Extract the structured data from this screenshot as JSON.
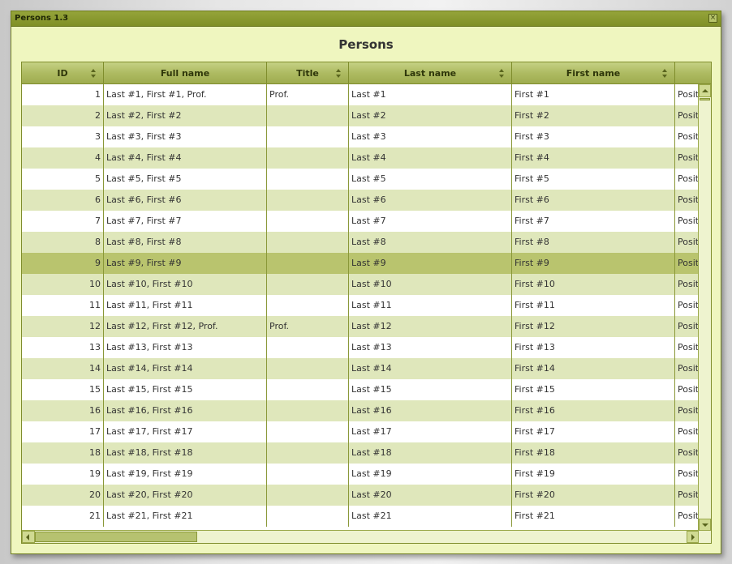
{
  "window": {
    "title": "Persons 1.3",
    "close_glyph": "×"
  },
  "page": {
    "heading": "Persons"
  },
  "table": {
    "columns": [
      {
        "label": "ID",
        "sortable": true
      },
      {
        "label": "Full name",
        "sortable": false
      },
      {
        "label": "Title",
        "sortable": true
      },
      {
        "label": "Last name",
        "sortable": true
      },
      {
        "label": "First name",
        "sortable": true
      },
      {
        "label": "",
        "sortable": false
      }
    ],
    "selected_row": 9,
    "rows": [
      {
        "id": "1",
        "full_name": "Last #1, First #1, Prof.",
        "title": "Prof.",
        "last_name": "Last #1",
        "first_name": "First #1",
        "position": "Posit"
      },
      {
        "id": "2",
        "full_name": "Last #2, First #2",
        "title": "",
        "last_name": "Last #2",
        "first_name": "First #2",
        "position": "Posit"
      },
      {
        "id": "3",
        "full_name": "Last #3, First #3",
        "title": "",
        "last_name": "Last #3",
        "first_name": "First #3",
        "position": "Posit"
      },
      {
        "id": "4",
        "full_name": "Last #4, First #4",
        "title": "",
        "last_name": "Last #4",
        "first_name": "First #4",
        "position": "Posit"
      },
      {
        "id": "5",
        "full_name": "Last #5, First #5",
        "title": "",
        "last_name": "Last #5",
        "first_name": "First #5",
        "position": "Posit"
      },
      {
        "id": "6",
        "full_name": "Last #6, First #6",
        "title": "",
        "last_name": "Last #6",
        "first_name": "First #6",
        "position": "Posit"
      },
      {
        "id": "7",
        "full_name": "Last #7, First #7",
        "title": "",
        "last_name": "Last #7",
        "first_name": "First #7",
        "position": "Posit"
      },
      {
        "id": "8",
        "full_name": "Last #8, First #8",
        "title": "",
        "last_name": "Last #8",
        "first_name": "First #8",
        "position": "Posit"
      },
      {
        "id": "9",
        "full_name": "Last #9, First #9",
        "title": "",
        "last_name": "Last #9",
        "first_name": "First #9",
        "position": "Posit"
      },
      {
        "id": "10",
        "full_name": "Last #10, First #10",
        "title": "",
        "last_name": "Last #10",
        "first_name": "First #10",
        "position": "Posit"
      },
      {
        "id": "11",
        "full_name": "Last #11, First #11",
        "title": "",
        "last_name": "Last #11",
        "first_name": "First #11",
        "position": "Posit"
      },
      {
        "id": "12",
        "full_name": "Last #12, First #12, Prof.",
        "title": "Prof.",
        "last_name": "Last #12",
        "first_name": "First #12",
        "position": "Posit"
      },
      {
        "id": "13",
        "full_name": "Last #13, First #13",
        "title": "",
        "last_name": "Last #13",
        "first_name": "First #13",
        "position": "Posit"
      },
      {
        "id": "14",
        "full_name": "Last #14, First #14",
        "title": "",
        "last_name": "Last #14",
        "first_name": "First #14",
        "position": "Posit"
      },
      {
        "id": "15",
        "full_name": "Last #15, First #15",
        "title": "",
        "last_name": "Last #15",
        "first_name": "First #15",
        "position": "Posit"
      },
      {
        "id": "16",
        "full_name": "Last #16, First #16",
        "title": "",
        "last_name": "Last #16",
        "first_name": "First #16",
        "position": "Posit"
      },
      {
        "id": "17",
        "full_name": "Last #17, First #17",
        "title": "",
        "last_name": "Last #17",
        "first_name": "First #17",
        "position": "Posit"
      },
      {
        "id": "18",
        "full_name": "Last #18, First #18",
        "title": "",
        "last_name": "Last #18",
        "first_name": "First #18",
        "position": "Posit"
      },
      {
        "id": "19",
        "full_name": "Last #19, First #19",
        "title": "",
        "last_name": "Last #19",
        "first_name": "First #19",
        "position": "Posit"
      },
      {
        "id": "20",
        "full_name": "Last #20, First #20",
        "title": "",
        "last_name": "Last #20",
        "first_name": "First #20",
        "position": "Posit"
      },
      {
        "id": "21",
        "full_name": "Last #21, First #21",
        "title": "",
        "last_name": "Last #21",
        "first_name": "First #21",
        "position": "Posit"
      }
    ]
  },
  "colors": {
    "window_bg": "#eff6bf",
    "titlebar": "#7f8f26",
    "row_alt": "#dfe7bb",
    "row_selected": "#b9c46e",
    "grid_border": "#7f8d2c"
  }
}
